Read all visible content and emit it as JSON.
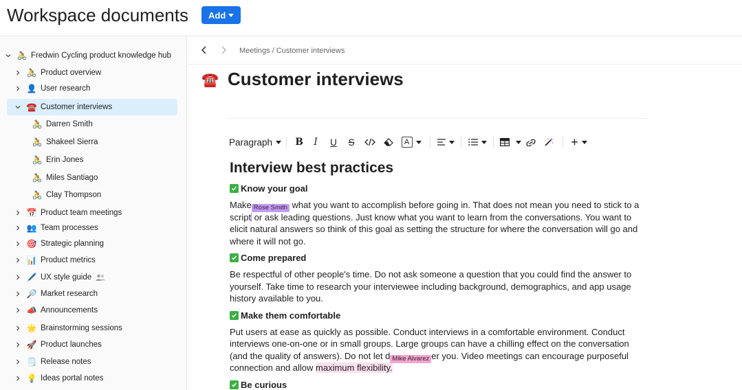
{
  "header": {
    "title": "Workspace documents",
    "add_label": "Add"
  },
  "sidebar": {
    "root": {
      "label": "Fredwin Cycling product knowledge hub",
      "emoji": "🚴"
    },
    "items": [
      {
        "label": "Product overview",
        "emoji": "🚴"
      },
      {
        "label": "User research",
        "emoji": "👤"
      },
      {
        "label": "Customer interviews",
        "emoji": "☎️"
      },
      {
        "label": "Darren Smith",
        "emoji": "🚴"
      },
      {
        "label": "Shakeel Sierra",
        "emoji": "🚴"
      },
      {
        "label": "Erin Jones",
        "emoji": "🚴"
      },
      {
        "label": "Miles Santiago",
        "emoji": "🚴"
      },
      {
        "label": "Clay Thompson",
        "emoji": "🚴"
      },
      {
        "label": "Product team meetings",
        "emoji": "📅"
      },
      {
        "label": "Team processes",
        "emoji": "👥"
      },
      {
        "label": "Strategic planning",
        "emoji": "🎯"
      },
      {
        "label": "Product metrics",
        "emoji": "📊"
      },
      {
        "label": "UX style guide",
        "emoji": "🖊️"
      },
      {
        "label": "Market research",
        "emoji": "🔎"
      },
      {
        "label": "Announcements",
        "emoji": "📣"
      },
      {
        "label": "Brainstorming sessions",
        "emoji": "🌟"
      },
      {
        "label": "Product launches",
        "emoji": "🚀"
      },
      {
        "label": "Release notes",
        "emoji": "🗒️"
      },
      {
        "label": "Ideas portal notes",
        "emoji": "💡"
      }
    ]
  },
  "breadcrumb": "Meetings / Customer interviews",
  "document": {
    "icon": "☎️",
    "title": "Customer interviews",
    "toolbar": {
      "paragraph_label": "Paragraph",
      "text_color_label": "A"
    },
    "heading": "Interview best practices",
    "sections": [
      {
        "title": "Know your goal",
        "p_start": "Make",
        "tag": "Rose Smith",
        "p_middle": " what you want to accomplish before going in. That does not mean you need to stick to a script",
        "p_end": " or ask leading questions. Just know what you want to learn from the conversations. You want to elicit natural answers so think of this goal as setting the structure for where the conversation will go and where it will not go."
      },
      {
        "title": "Come prepared",
        "text": "Be respectful of other people's time. Do not ask someone a question that you could find the answer to yourself. Take time to research your interviewee including background, demographics, and app usage history available to you."
      },
      {
        "title": "Make them comfortable",
        "p_start": "Put users at ease as quickly as possible. Conduct interviews in a comfortable environment. Conduct interviews one-on-one or in small groups. Large groups can have a chilling effect on the conversation (and the quality of answers). Do not let d",
        "tag": "Mike Alvarez",
        "p_middle": "er you. Video meetings can encourage purposeful connection and allow ",
        "p_highlight": "maximum flexibility."
      },
      {
        "title": "Be curious"
      }
    ]
  },
  "colors": {
    "accent": "#1a73e8",
    "active_row": "#dbeefc",
    "rose_cursor": "#c49cf1",
    "mike_cursor": "#f2a6cf",
    "check_green": "#3cb043"
  }
}
